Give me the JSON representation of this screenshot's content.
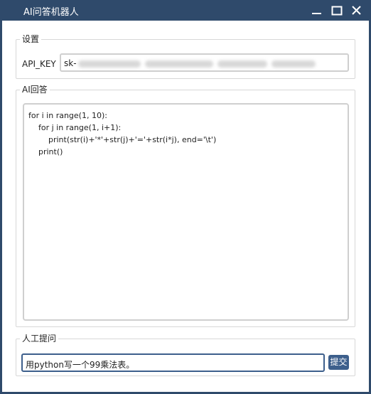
{
  "window": {
    "title": "AI问答机器人",
    "controls": [
      "minimize",
      "maximize",
      "close"
    ]
  },
  "settings": {
    "group_label": "设置",
    "api_key_label": "API_KEY",
    "api_key_value": "sk-"
  },
  "answer": {
    "group_label": "AI回答",
    "content": "for i in range(1, 10):\n    for j in range(1, i+1):\n        print(str(i)+'*'+str(j)+'='+str(i*j), end='\\t')\n    print()"
  },
  "question": {
    "group_label": "人工提问",
    "input_value": "用python写一个99乘法表。",
    "submit_label": "提交"
  },
  "colors": {
    "titlebar": "#2f4a6b",
    "accent": "#3d5f8c",
    "client_bg": "#ffffff"
  }
}
